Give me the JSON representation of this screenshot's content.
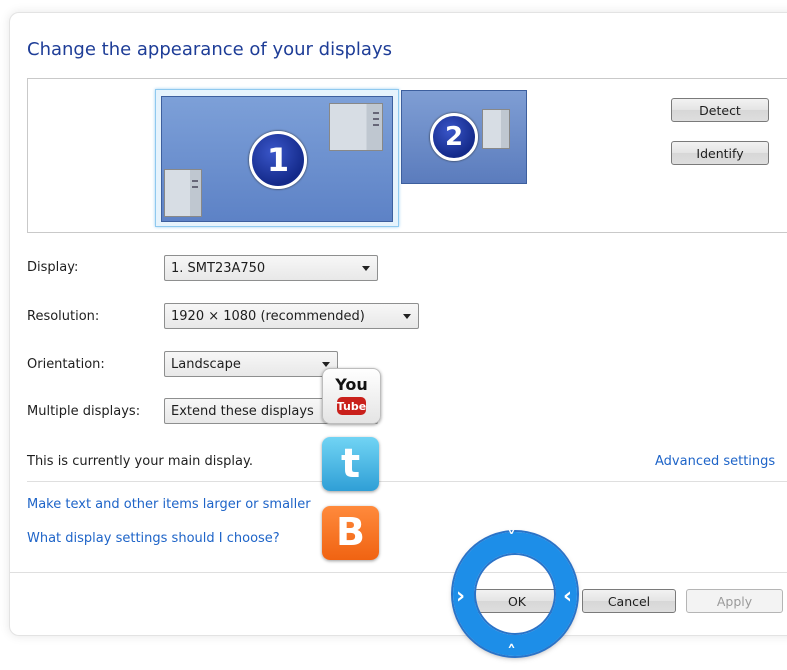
{
  "title": "Change the appearance of your displays",
  "monitors": [
    {
      "number": "1",
      "selected": true
    },
    {
      "number": "2",
      "selected": false
    }
  ],
  "buttons": {
    "detect": "Detect",
    "identify": "Identify",
    "ok": "OK",
    "cancel": "Cancel",
    "apply": "Apply"
  },
  "fields": {
    "display": {
      "label": "Display:",
      "value": "1. SMT23A750"
    },
    "resolution": {
      "label": "Resolution:",
      "value": "1920 × 1080 (recommended)"
    },
    "orientation": {
      "label": "Orientation:",
      "value": "Landscape"
    },
    "multiple": {
      "label": "Multiple displays:",
      "value": "Extend these displays"
    }
  },
  "status_text": "This is currently your main display.",
  "links": {
    "advanced": "Advanced settings",
    "larger": "Make text and other items larger or smaller",
    "which": "What display settings should I choose?"
  },
  "social": {
    "youtube_top": "You",
    "youtube_bottom": "Tube",
    "twitter": "t",
    "blogger": "B"
  },
  "nav_ring": {
    "up": "˄",
    "down": "˅",
    "left": "›",
    "right": "‹"
  },
  "colors": {
    "title": "#1e3d97",
    "link": "#1e64c8",
    "ring": "#1d8ee8"
  }
}
